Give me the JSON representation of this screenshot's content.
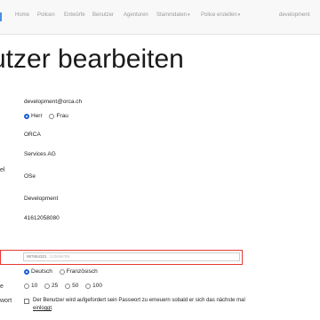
{
  "nav": {
    "items": [
      "Home",
      "Policen",
      "Entwürfe",
      "Benutzer",
      "Agenturen",
      "Stammdaten",
      "Police erstellen",
      "development"
    ],
    "dropdowns": [
      false,
      false,
      false,
      false,
      false,
      true,
      true,
      false
    ]
  },
  "page_title": "utzer bearbeiten",
  "fields": {
    "email": "development@orca.ch",
    "salutation_options": [
      "Herr",
      "Frau"
    ],
    "salutation_selected": "Herr",
    "company1": "ORCA",
    "company2": "Services AG",
    "label_fragment_el": "el",
    "city": "OSe",
    "department": "Development",
    "phone": "41612058080"
  },
  "highlighted_input": {
    "value": "987654321",
    "placeholder": "123456789"
  },
  "language": {
    "options": [
      "Deutsch",
      "Französisch"
    ],
    "selected": "Deutsch"
  },
  "page_size": {
    "label_fragment": "e",
    "options": [
      "10",
      "25",
      "50",
      "100"
    ]
  },
  "password_reset": {
    "label_fragment": "wort",
    "text_part1": "Der Benutzer wird aufgefordert sein Passwort zu erneuern sobald er sich das nächste mal ",
    "text_link": "einloggt",
    "text_end": "."
  }
}
